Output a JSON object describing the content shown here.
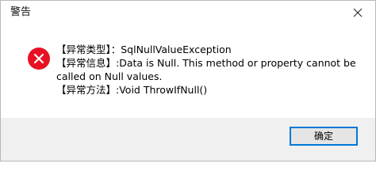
{
  "window": {
    "title": "警告"
  },
  "message": {
    "lines": [
      "【异常类型】：SqlNullValueException",
      "【异常信息】:Data is Null. This method or property cannot be called on Null values.",
      "【异常方法】:Void ThrowIfNull()"
    ]
  },
  "icons": {
    "error": "error-icon",
    "close": "close-icon"
  },
  "buttons": {
    "ok_label": "确定"
  },
  "colors": {
    "error_red": "#e81123",
    "focus_blue": "#0078d7",
    "footer_bg": "#f0f0f0"
  }
}
